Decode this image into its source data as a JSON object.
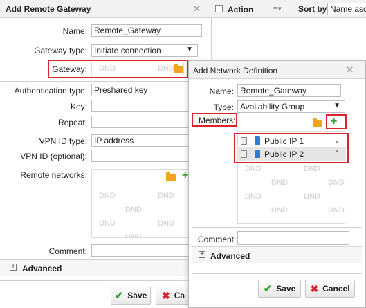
{
  "left_dialog": {
    "title": "Add Remote Gateway",
    "close_glyph": "✕",
    "name_label": "Name:",
    "name_value": "Remote_Gateway",
    "gateway_type_label": "Gateway type:",
    "gateway_type_value": "Initiate connection",
    "gateway_label": "Gateway:",
    "gateway_dnd": "DND",
    "auth_type_label": "Authentication type:",
    "auth_type_value": "Preshared key",
    "key_label": "Key:",
    "repeat_label": "Repeat:",
    "vpn_id_type_label": "VPN ID type:",
    "vpn_id_type_value": "IP address",
    "vpn_id_optional_label": "VPN ID (optional):",
    "remote_networks_label": "Remote networks:",
    "dnd": "DND",
    "comment_label": "Comment:",
    "advanced_label": "Advanced",
    "save_label": "Save",
    "cancel_label": "Ca"
  },
  "list_header": {
    "action_label": "Action",
    "sort_by_label": "Sort by:",
    "sort_by_value": "Name asc"
  },
  "right_dialog": {
    "title": "Add Network Definition",
    "close_glyph": "✕",
    "name_label": "Name:",
    "name_value": "Remote_Gateway",
    "type_label": "Type:",
    "type_value": "Availability Group",
    "members_label": "Members:",
    "members": [
      {
        "label": "Public IP 1"
      },
      {
        "label": "Public IP 2"
      }
    ],
    "dnd": "DND",
    "comment_label": "Comment:",
    "advanced_label": "Advanced",
    "save_label": "Save",
    "cancel_label": "Cancel"
  },
  "colors": {
    "highlight_red": "#d9232d",
    "plus_green": "#3aa335",
    "folder_orange": "#f0a31c"
  }
}
